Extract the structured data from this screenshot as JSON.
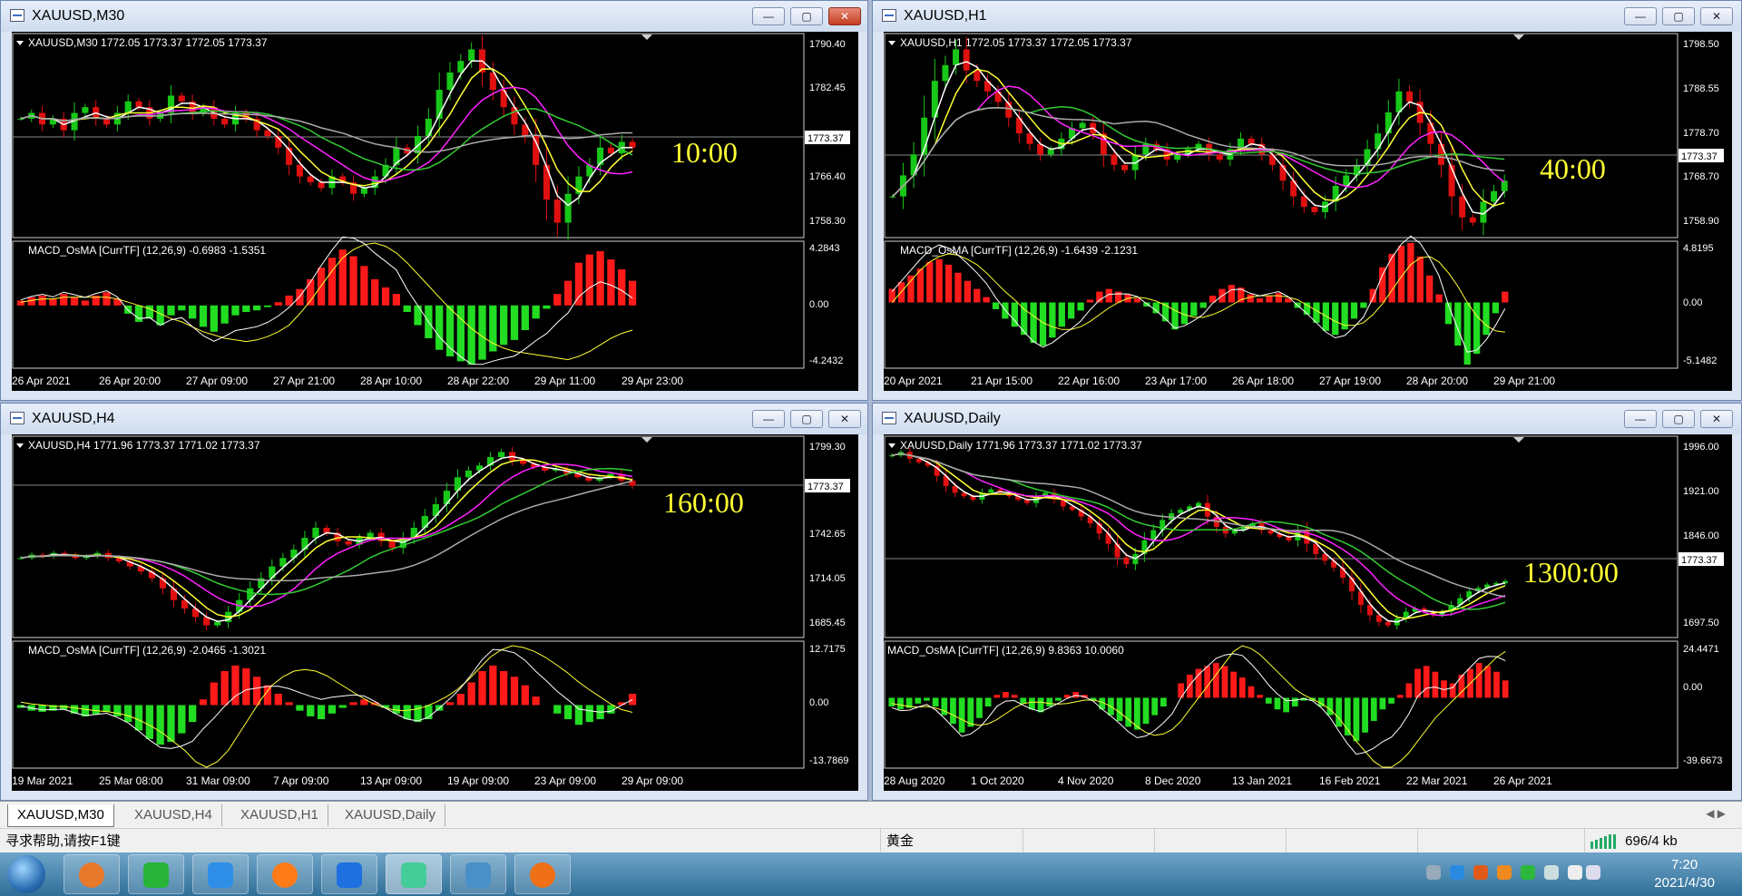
{
  "windows": [
    {
      "title": "XAUUSD,M30",
      "info": "XAUUSD,M30  1772.05 1773.37 1772.05 1773.37",
      "timer": "10:00",
      "price_ticks": [
        "1790.40",
        "1782.45",
        "1766.40",
        "1758.30"
      ],
      "price_marker": "1773.37",
      "macd_label": "MACD_OsMA [CurrTF] (12,26,9) -0.6983 -1.5351",
      "macd_ticks": [
        "4.2843",
        "0.00",
        "-4.2432"
      ],
      "dates": [
        "26 Apr 2021",
        "26 Apr 20:00",
        "27 Apr 09:00",
        "27 Apr 21:00",
        "28 Apr 10:00",
        "28 Apr 22:00",
        "29 Apr 11:00",
        "29 Apr 23:00"
      ]
    },
    {
      "title": "XAUUSD,H1",
      "info": "XAUUSD,H1  1772.05 1773.37 1772.05 1773.37",
      "timer": "40:00",
      "price_ticks": [
        "1798.50",
        "1788.55",
        "1778.70",
        "1768.70",
        "1758.90"
      ],
      "price_marker": "1773.37",
      "macd_label": "MACD_OsMA [CurrTF] (12,26,9) -1.6439 -2.1231",
      "macd_ticks": [
        "4.8195",
        "0.00",
        "-5.1482"
      ],
      "dates": [
        "20 Apr 2021",
        "21 Apr 15:00",
        "22 Apr 16:00",
        "23 Apr 17:00",
        "26 Apr 18:00",
        "27 Apr 19:00",
        "28 Apr 20:00",
        "29 Apr 21:00"
      ]
    },
    {
      "title": "XAUUSD,H4",
      "info": "XAUUSD,H4  1771.96 1773.37 1771.02 1773.37",
      "timer": "160:00",
      "price_ticks": [
        "1799.30",
        "1742.65",
        "1714.05",
        "1685.45"
      ],
      "price_marker": "1773.37",
      "macd_label": "MACD_OsMA [CurrTF] (12,26,9) -2.0465 -1.3021",
      "macd_ticks": [
        "12.7175",
        "0.00",
        "-13.7869"
      ],
      "dates": [
        "19 Mar 2021",
        "25 Mar 08:00",
        "31 Mar 09:00",
        "7 Apr 09:00",
        "13 Apr 09:00",
        "19 Apr 09:00",
        "23 Apr 09:00",
        "29 Apr 09:00"
      ]
    },
    {
      "title": "XAUUSD,Daily",
      "info": "XAUUSD,Daily  1771.96 1773.37 1771.02 1773.37",
      "timer": "1300:00",
      "price_ticks": [
        "1996.00",
        "1921.00",
        "1846.00",
        "1697.50"
      ],
      "price_marker": "1773.37",
      "macd_label": "MACD_OsMA [CurrTF] (12,26,9) 9.8363 10.0060",
      "macd_ticks": [
        "24.4471",
        "0.00",
        "-39.6673"
      ],
      "dates": [
        "28 Aug 2020",
        "1 Oct 2020",
        "4 Nov 2020",
        "8 Dec 2020",
        "13 Jan 2021",
        "16 Feb 2021",
        "22 Mar 2021",
        "26 Apr 2021"
      ]
    }
  ],
  "window_buttons": {
    "minimize": "—",
    "maximize": "▢",
    "close": "✕"
  },
  "tabs": [
    "XAUUSD,M30",
    "XAUUSD,H4",
    "XAUUSD,H1",
    "XAUUSD,Daily"
  ],
  "tab_arrows": "◀ ▶",
  "status": {
    "help": "寻求帮助,请按F1键",
    "symbol": "黄金",
    "traffic": "696/4 kb"
  },
  "clock": {
    "time": "7:20",
    "date": "2021/4/30"
  },
  "colors": {
    "bull": "#18c818",
    "bear": "#e01010",
    "ma_fast": "#ffffff",
    "ma_mid": "#ffff33",
    "ma_slow": "#ff22ff",
    "ma_green": "#33cc33",
    "ma_gray": "#aaaaaa",
    "timer": "#ffff33",
    "hist_up": "#ff1a1a",
    "hist_down": "#22dd22"
  },
  "charts": [
    {
      "closes": [
        1778,
        1779,
        1777,
        1778,
        1776,
        1779,
        1780,
        1778,
        1777,
        1779,
        1781,
        1780,
        1778,
        1779,
        1782,
        1781,
        1779,
        1780,
        1778,
        1777,
        1779,
        1778,
        1776,
        1775,
        1773,
        1770,
        1768,
        1767,
        1766,
        1768,
        1767,
        1765,
        1766,
        1768,
        1770,
        1773,
        1772,
        1775,
        1778,
        1783,
        1786,
        1788,
        1790,
        1786,
        1783,
        1780,
        1777,
        1775,
        1770,
        1764,
        1760,
        1765,
        1768,
        1770,
        1773,
        1772,
        1774,
        1773
      ],
      "macd_hist": [
        0.3,
        0.5,
        0.6,
        0.4,
        0.7,
        0.5,
        0.3,
        0.6,
        0.8,
        0.4,
        -0.5,
        -1,
        -0.8,
        -1.2,
        -0.6,
        -0.3,
        -0.8,
        -1.3,
        -1.6,
        -1.1,
        -0.6,
        -0.4,
        -0.3,
        -0.1,
        0.2,
        0.6,
        1,
        1.6,
        2.3,
        2.9,
        3.4,
        3,
        2.4,
        1.6,
        1.1,
        0.7,
        -0.4,
        -1.2,
        -2,
        -2.7,
        -3.1,
        -3.4,
        -3.6,
        -3.3,
        -2.8,
        -2.4,
        -2.1,
        -1.5,
        -0.8,
        -0.2,
        0.7,
        1.5,
        2.6,
        3.1,
        3.3,
        2.8,
        2.2,
        1.5
      ],
      "macd_signal": [
        0.2,
        0.3,
        0.4,
        0.4,
        0.5,
        0.5,
        0.5,
        0.5,
        0.5,
        0.4,
        0.2,
        0,
        -0.2,
        -0.5,
        -0.8,
        -1,
        -1.3,
        -1.6,
        -1.8,
        -2,
        -2.1,
        -2.2,
        -2.1,
        -1.9,
        -1.6,
        -1.2,
        -0.5,
        0.3,
        1.2,
        2.1,
        2.9,
        3.4,
        3.7,
        3.8,
        3.6,
        3.2,
        2.6,
        1.9,
        1.2,
        0.5,
        -0.2,
        -0.8,
        -1.4,
        -1.9,
        -2.3,
        -2.6,
        -2.8,
        -2.9,
        -3,
        -3.1,
        -3.2,
        -3.3,
        -3.1,
        -2.8,
        -2.4,
        -2,
        -1.7,
        -1.5
      ]
    },
    {
      "closes": [
        1770,
        1774,
        1778,
        1785,
        1792,
        1795,
        1798,
        1794,
        1792,
        1790,
        1788,
        1785,
        1782,
        1780,
        1778,
        1779,
        1781,
        1783,
        1784,
        1782,
        1778,
        1776,
        1775,
        1778,
        1780,
        1779,
        1777,
        1778,
        1779,
        1780,
        1778,
        1777,
        1779,
        1781,
        1780,
        1778,
        1776,
        1773,
        1770,
        1768,
        1767,
        1769,
        1772,
        1774,
        1776,
        1779,
        1782,
        1786,
        1790,
        1788,
        1784,
        1780,
        1776,
        1770,
        1766,
        1765,
        1769,
        1771,
        1773
      ],
      "macd_hist": [
        1,
        1.5,
        2,
        2.5,
        3,
        3.2,
        2.8,
        2.2,
        1.6,
        1,
        0.4,
        -0.5,
        -1.2,
        -1.8,
        -2.4,
        -3,
        -3.2,
        -2.6,
        -1.8,
        -1.2,
        -0.6,
        0.2,
        0.8,
        1,
        0.8,
        0.6,
        0.3,
        -0.3,
        -0.8,
        -1.4,
        -2,
        -1.6,
        -1,
        -0.4,
        0.5,
        1,
        1.3,
        1.1,
        0.6,
        0.3,
        0.5,
        0.7,
        0.3,
        -0.4,
        -0.9,
        -1.5,
        -2.1,
        -2.4,
        -2,
        -1.2,
        -0.4,
        1,
        2.6,
        3.6,
        4.2,
        4.4,
        3.4,
        2,
        0.6,
        -1.6,
        -3.2,
        -4.6,
        -3.8,
        -2.4,
        -0.8,
        0.8
      ],
      "macd_signal": [
        0,
        0.8,
        1.6,
        2.4,
        3,
        3.4,
        3.6,
        3.5,
        3.2,
        2.8,
        2.2,
        1.5,
        0.8,
        0.2,
        -0.5,
        -1,
        -1.5,
        -1.8,
        -2,
        -2,
        -1.8,
        -1.4,
        -0.9,
        -0.4,
        0,
        0.3,
        0.4,
        0.3,
        0.1,
        -0.2,
        -0.6,
        -0.9,
        -1.1,
        -1.1,
        -0.9,
        -0.6,
        -0.2,
        0.2,
        0.4,
        0.5,
        0.5,
        0.5,
        0.4,
        0.2,
        -0.2,
        -0.6,
        -1,
        -1.4,
        -1.7,
        -1.7,
        -1.5,
        -0.9,
        -0.1,
        0.9,
        1.9,
        2.8,
        3.3,
        3.4,
        3,
        2.2,
        1.2,
        0,
        -1,
        -1.7,
        -2.1,
        -2.2
      ]
    },
    {
      "closes": [
        1730,
        1732,
        1731,
        1733,
        1732,
        1730,
        1731,
        1733,
        1730,
        1728,
        1725,
        1722,
        1718,
        1712,
        1705,
        1700,
        1695,
        1690,
        1692,
        1698,
        1705,
        1712,
        1718,
        1725,
        1730,
        1735,
        1742,
        1748,
        1745,
        1740,
        1738,
        1742,
        1745,
        1740,
        1736,
        1742,
        1748,
        1755,
        1762,
        1770,
        1778,
        1782,
        1785,
        1790,
        1793,
        1788,
        1786,
        1784,
        1782,
        1783,
        1780,
        1778,
        1776,
        1778,
        1780,
        1776,
        1773
      ],
      "macd_hist": [
        -0.5,
        -1,
        -1.2,
        -1,
        -0.8,
        -1.5,
        -2,
        -1.6,
        -1.2,
        -2,
        -3,
        -4.5,
        -6,
        -7,
        -6.5,
        -5,
        -3,
        1,
        4,
        6,
        7,
        6.5,
        5,
        3.5,
        2,
        0.5,
        -1,
        -2,
        -2.5,
        -1.5,
        -0.5,
        0.5,
        1,
        0.5,
        -0.5,
        -1.5,
        -2.5,
        -3,
        -2.5,
        -1,
        0.5,
        2,
        4,
        6,
        7,
        6,
        5,
        3.5,
        1.5,
        0,
        -1.5,
        -2.5,
        -3.5,
        -3,
        -2.5,
        -1.5,
        0.5,
        2
      ],
      "macd_signal": [
        0.5,
        0.2,
        0,
        -0.2,
        -0.3,
        -0.5,
        -0.8,
        -1,
        -1.2,
        -1.5,
        -2,
        -2.8,
        -3.8,
        -5,
        -6.5,
        -8,
        -10,
        -11,
        -10,
        -8,
        -5,
        -2,
        1,
        3.5,
        5,
        6,
        6.3,
        6,
        5.2,
        4,
        2.8,
        1.6,
        0.5,
        -0.3,
        -0.8,
        -1,
        -0.8,
        -0.3,
        0.5,
        1.5,
        2.8,
        4.5,
        6.5,
        8.5,
        9.8,
        10.5,
        10.2,
        9.5,
        8.5,
        7.2,
        5.8,
        4.2,
        2.8,
        1.5,
        0.2,
        -0.8,
        -1.3
      ]
    },
    {
      "closes": [
        1960,
        1965,
        1955,
        1950,
        1945,
        1930,
        1915,
        1905,
        1900,
        1895,
        1905,
        1910,
        1905,
        1900,
        1895,
        1890,
        1900,
        1905,
        1895,
        1885,
        1880,
        1870,
        1860,
        1845,
        1830,
        1810,
        1800,
        1815,
        1835,
        1850,
        1865,
        1875,
        1880,
        1885,
        1890,
        1870,
        1855,
        1845,
        1850,
        1855,
        1860,
        1850,
        1845,
        1840,
        1835,
        1850,
        1830,
        1815,
        1805,
        1795,
        1780,
        1760,
        1740,
        1725,
        1715,
        1710,
        1720,
        1730,
        1735,
        1730,
        1725,
        1730,
        1740,
        1750,
        1760,
        1765,
        1770,
        1772,
        1775
      ],
      "macd_hist": [
        -3,
        -4,
        -3.5,
        -2,
        -1,
        -3,
        -6,
        -9,
        -12,
        -10,
        -7,
        -3,
        1,
        2,
        1,
        -2,
        -4,
        -5,
        -3,
        -1,
        1,
        2,
        1,
        -1,
        -4,
        -6,
        -8,
        -10,
        -11,
        -9,
        -6,
        -3,
        0,
        5,
        8,
        10,
        11,
        12,
        11,
        9,
        7,
        4,
        1,
        -2,
        -4,
        -5,
        -3,
        -1,
        -1,
        -3,
        -6,
        -10,
        -13,
        -15,
        -12,
        -8,
        -4,
        -2,
        1,
        5,
        10,
        11,
        9,
        6,
        5,
        8,
        10,
        12,
        11,
        9,
        6
      ],
      "macd_signal": [
        -2,
        -2.5,
        -3,
        -3.2,
        -3,
        -3.5,
        -4.5,
        -6,
        -7.5,
        -9,
        -9.5,
        -9,
        -7.5,
        -5.5,
        -3.5,
        -2,
        -1.5,
        -1.5,
        -2,
        -2.2,
        -2,
        -1.4,
        -0.8,
        -0.8,
        -1.5,
        -3,
        -5,
        -7.5,
        -10,
        -12,
        -13,
        -12.5,
        -11,
        -8,
        -4,
        0,
        4,
        8,
        12,
        16,
        18,
        17,
        15,
        12,
        9,
        6,
        3,
        1,
        -0.5,
        -2,
        -4,
        -7,
        -11,
        -15,
        -18.5,
        -22,
        -24,
        -24,
        -22,
        -19,
        -15,
        -11,
        -7,
        -4,
        -1,
        2,
        5,
        8,
        11,
        14,
        16
      ]
    }
  ]
}
